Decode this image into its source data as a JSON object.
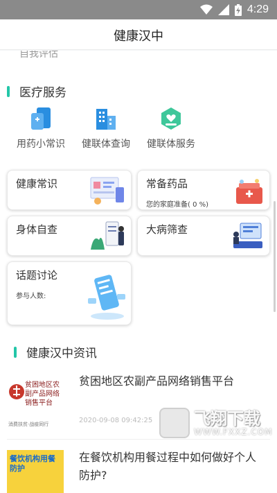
{
  "status_bar": {
    "time": "4:29",
    "icons": [
      "wifi-icon",
      "signal-icon",
      "battery-charging-icon"
    ]
  },
  "app_bar": {
    "title": "健康汉中"
  },
  "cut_off_item": "自我评估",
  "medical_services": {
    "heading": "医疗服务",
    "items": [
      {
        "label": "用药小常识",
        "icon": "medicine-card-icon"
      },
      {
        "label": "健联体查询",
        "icon": "hospital-building-icon"
      },
      {
        "label": "健联体服务",
        "icon": "heart-hand-icon"
      }
    ]
  },
  "cards": [
    {
      "title": "健康常识",
      "subtitle": ""
    },
    {
      "title": "常备药品",
      "subtitle": "您的家庭准备( 0 %)"
    },
    {
      "title": "身体自查",
      "subtitle": ""
    },
    {
      "title": "大病筛查",
      "subtitle": ""
    },
    {
      "title": "话题讨论",
      "subtitle": "参与人数:"
    }
  ],
  "news_section": {
    "heading": "健康汉中资讯",
    "items": [
      {
        "title": "贫困地区农副产品网络销售平台",
        "date": "2020-09-08 09:42:25",
        "thumb_text": "贫困地区农副产品网络销售平台",
        "thumb_caption": "消费扶贫·战疫同行"
      },
      {
        "title": "在餐饮机构用餐过程中如何做好个人防护?",
        "date": "",
        "thumb_text": "餐饮机构用餐防护"
      }
    ]
  },
  "watermark": {
    "name": "飞翔下载",
    "url": "WWW.FXXZ.COM"
  },
  "colors": {
    "accent": "#23c6a8",
    "service_blue": "#2a8ee0",
    "service_green": "#3ec79a"
  }
}
